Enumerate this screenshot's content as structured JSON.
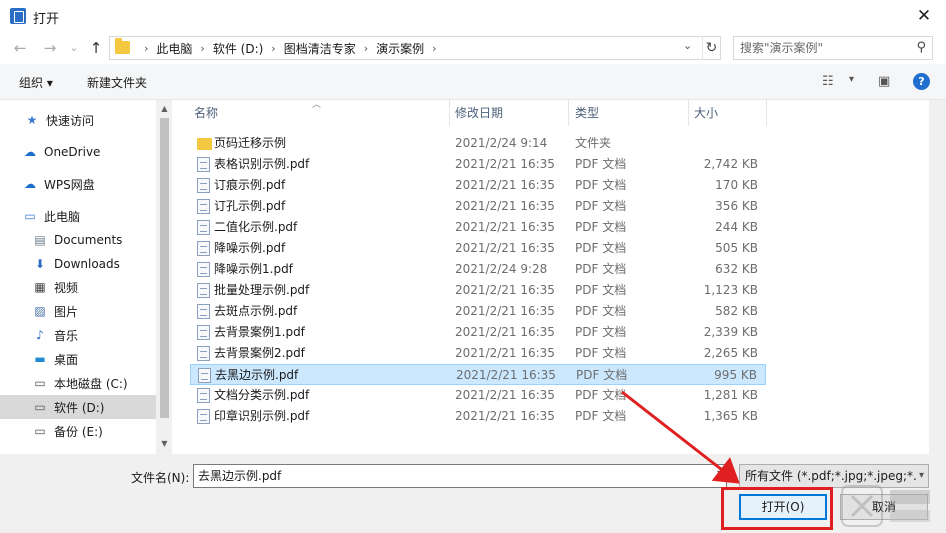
{
  "window": {
    "title": "打开",
    "close_glyph": "✕"
  },
  "nav": {
    "back_glyph": "←",
    "forward_glyph": "→",
    "recent_glyph": "⌄",
    "up_glyph": "↑",
    "breadcrumb": [
      "此电脑",
      "软件 (D:)",
      "图档清洁专家",
      "演示案例"
    ],
    "search_placeholder": "搜索\"演示案例\""
  },
  "toolbar": {
    "organize_label": "组织 ▾",
    "new_folder_label": "新建文件夹"
  },
  "sidebar": {
    "items": [
      {
        "label": "快速访问",
        "icon": "star-icon"
      },
      {
        "label": "OneDrive",
        "icon": "cloud-icon"
      },
      {
        "label": "WPS网盘",
        "icon": "cloud-icon"
      },
      {
        "label": "此电脑",
        "icon": "computer-icon"
      },
      {
        "label": "Documents",
        "icon": "document-icon"
      },
      {
        "label": "Downloads",
        "icon": "download-icon"
      },
      {
        "label": "视频",
        "icon": "video-icon"
      },
      {
        "label": "图片",
        "icon": "picture-icon"
      },
      {
        "label": "音乐",
        "icon": "music-icon"
      },
      {
        "label": "桌面",
        "icon": "desktop-icon"
      },
      {
        "label": "本地磁盘 (C:)",
        "icon": "drive-icon"
      },
      {
        "label": "软件 (D:)",
        "icon": "drive-icon",
        "selected": true
      },
      {
        "label": "备份 (E:)",
        "icon": "drive-icon"
      }
    ]
  },
  "columns": {
    "name": "名称",
    "modified": "修改日期",
    "type": "类型",
    "size": "大小"
  },
  "files": [
    {
      "name": "页码迁移示例",
      "date": "2021/2/24 9:14",
      "type": "文件夹",
      "size": "",
      "icon": "folder"
    },
    {
      "name": "表格识别示例.pdf",
      "date": "2021/2/21 16:35",
      "type": "PDF 文档",
      "size": "2,742 KB",
      "icon": "pdf"
    },
    {
      "name": "订痕示例.pdf",
      "date": "2021/2/21 16:35",
      "type": "PDF 文档",
      "size": "170 KB",
      "icon": "pdf"
    },
    {
      "name": "订孔示例.pdf",
      "date": "2021/2/21 16:35",
      "type": "PDF 文档",
      "size": "356 KB",
      "icon": "pdf"
    },
    {
      "name": "二值化示例.pdf",
      "date": "2021/2/21 16:35",
      "type": "PDF 文档",
      "size": "244 KB",
      "icon": "pdf"
    },
    {
      "name": "降噪示例.pdf",
      "date": "2021/2/21 16:35",
      "type": "PDF 文档",
      "size": "505 KB",
      "icon": "pdf"
    },
    {
      "name": "降噪示例1.pdf",
      "date": "2021/2/24 9:28",
      "type": "PDF 文档",
      "size": "632 KB",
      "icon": "pdf"
    },
    {
      "name": "批量处理示例.pdf",
      "date": "2021/2/21 16:35",
      "type": "PDF 文档",
      "size": "1,123 KB",
      "icon": "pdf"
    },
    {
      "name": "去斑点示例.pdf",
      "date": "2021/2/21 16:35",
      "type": "PDF 文档",
      "size": "582 KB",
      "icon": "pdf"
    },
    {
      "name": "去背景案例1.pdf",
      "date": "2021/2/21 16:35",
      "type": "PDF 文档",
      "size": "2,339 KB",
      "icon": "pdf"
    },
    {
      "name": "去背景案例2.pdf",
      "date": "2021/2/21 16:35",
      "type": "PDF 文档",
      "size": "2,265 KB",
      "icon": "pdf"
    },
    {
      "name": "去黑边示例.pdf",
      "date": "2021/2/21 16:35",
      "type": "PDF 文档",
      "size": "995 KB",
      "icon": "pdf",
      "selected": true
    },
    {
      "name": "文档分类示例.pdf",
      "date": "2021/2/21 16:35",
      "type": "PDF 文档",
      "size": "1,281 KB",
      "icon": "pdf"
    },
    {
      "name": "印章识别示例.pdf",
      "date": "2021/2/21 16:35",
      "type": "PDF 文档",
      "size": "1,365 KB",
      "icon": "pdf"
    }
  ],
  "footer": {
    "filename_label": "文件名(N):",
    "filename_value": "去黑边示例.pdf",
    "filetype_value": "所有文件 (*.pdf;*.jpg;*.jpeg;*.j",
    "open_label": "打开(O)",
    "cancel_label": "取消"
  },
  "colors": {
    "accent": "#0078d7",
    "selection": "#cce8ff",
    "annotation": "#e02020"
  }
}
